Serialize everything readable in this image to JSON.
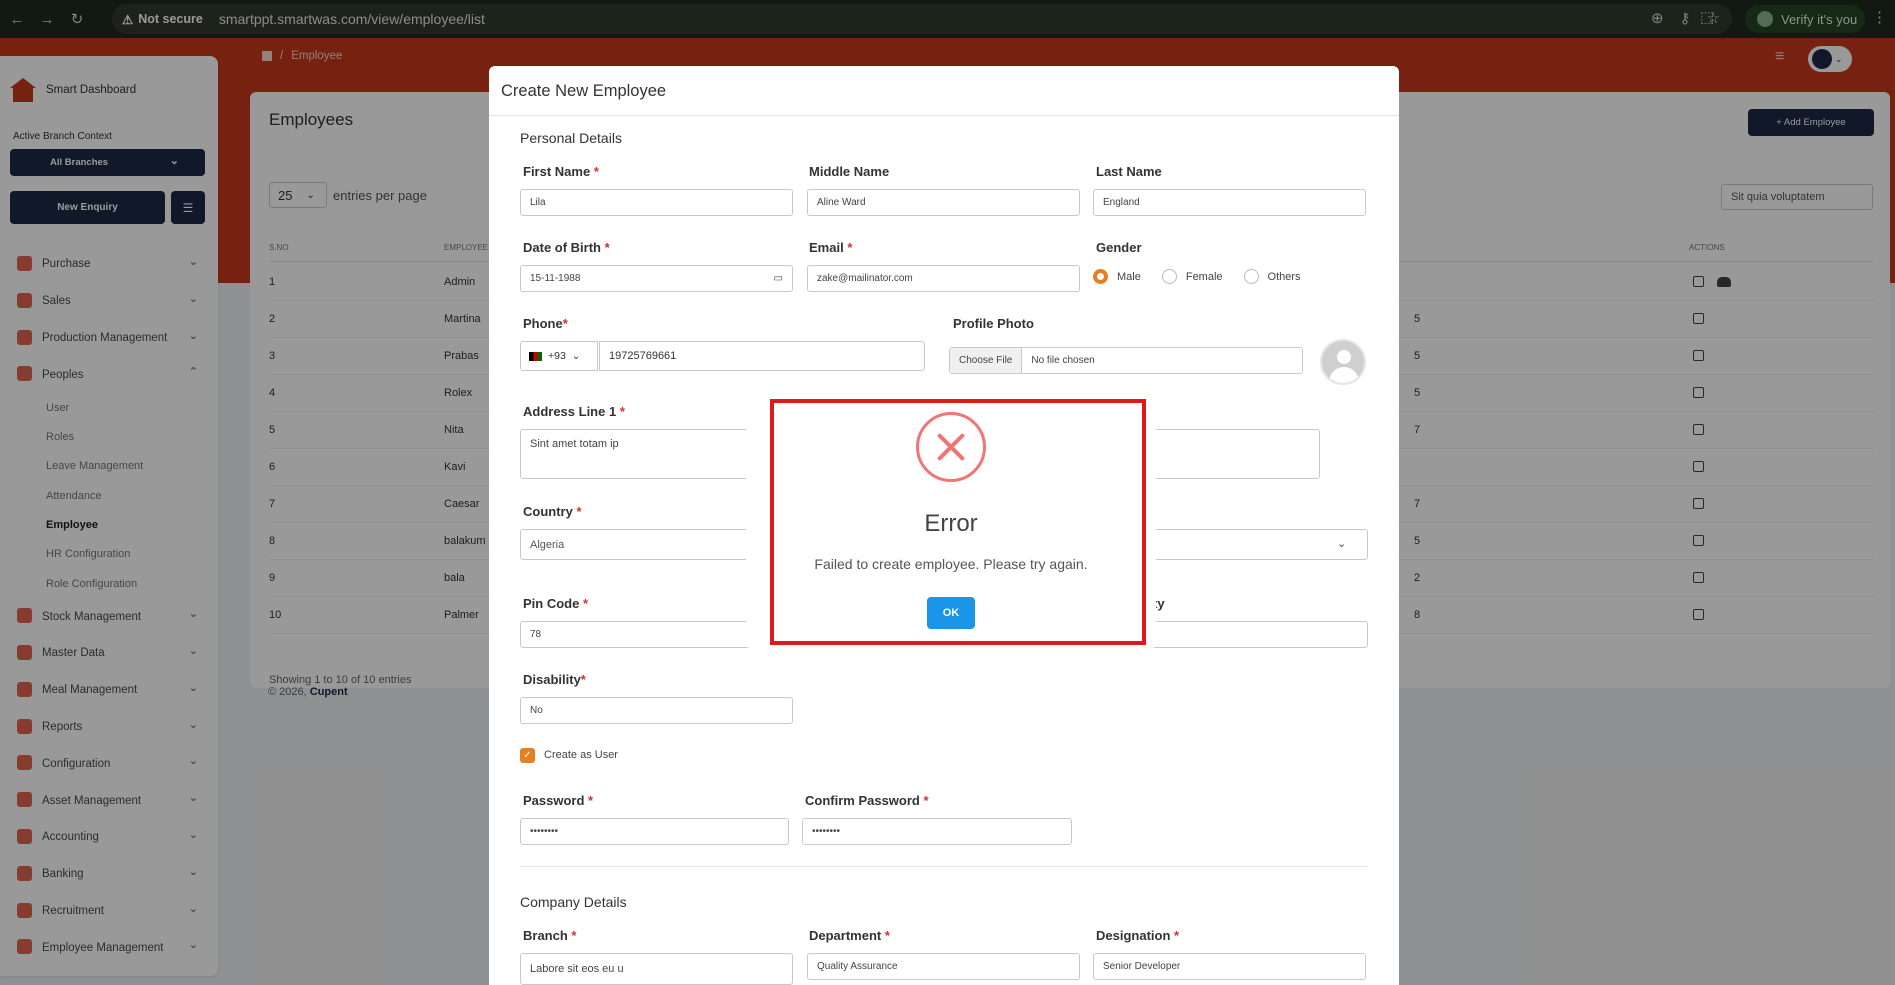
{
  "browser": {
    "security_label": "Not secure",
    "url": "smartppt.smartwas.com/view/employee/list",
    "verify_label": "Verify it's you"
  },
  "sidebar": {
    "brand": "Smart Dashboard",
    "context_label": "Active Branch Context",
    "branch_value": "All Branches",
    "new_enquiry": "New Enquiry",
    "items": [
      {
        "label": "Purchase"
      },
      {
        "label": "Sales"
      },
      {
        "label": "Production Management"
      },
      {
        "label": "Peoples"
      }
    ],
    "peoples_sub": [
      "User",
      "Roles",
      "Leave Management",
      "Attendance",
      "Employee",
      "HR Configuration",
      "Role Configuration"
    ],
    "items_after": [
      {
        "label": "Stock Management"
      },
      {
        "label": "Master Data"
      },
      {
        "label": "Meal Management"
      },
      {
        "label": "Reports"
      },
      {
        "label": "Configuration"
      },
      {
        "label": "Asset Management"
      },
      {
        "label": "Accounting"
      },
      {
        "label": "Banking"
      },
      {
        "label": "Recruitment"
      },
      {
        "label": "Employee Management"
      }
    ]
  },
  "breadcrumb": {
    "current": "Employee",
    "separator": "/"
  },
  "list": {
    "title": "Employees",
    "add_button": "+ Add Employee",
    "page_length": "25",
    "page_length_label": "entries per page",
    "search_value": "Sit quia voluptatem",
    "columns": {
      "sno": "S.NO",
      "employee": "EMPLOYEE",
      "actions": "ACTIONS"
    },
    "rows": [
      {
        "sno": "1",
        "name": "Admin"
      },
      {
        "sno": "2",
        "name": "Martina"
      },
      {
        "sno": "3",
        "name": "Prabas"
      },
      {
        "sno": "4",
        "name": "Rolex"
      },
      {
        "sno": "5",
        "name": "Nita"
      },
      {
        "sno": "6",
        "name": "Kavi"
      },
      {
        "sno": "7",
        "name": "Caesar"
      },
      {
        "sno": "8",
        "name": "balakum"
      },
      {
        "sno": "9",
        "name": "bala"
      },
      {
        "sno": "10",
        "name": "Palmer"
      }
    ],
    "right_fragments": [
      "",
      "5",
      "5",
      "5",
      "7",
      "",
      "7",
      "5",
      "2",
      "8"
    ],
    "showing": "Showing 1 to 10 of 10 entries"
  },
  "footer": {
    "copyright": "© 2026, ",
    "company": "Cupent"
  },
  "modal": {
    "title": "Create New Employee",
    "personal_section": "Personal Details",
    "labels": {
      "first_name": "First Name",
      "middle_name": "Middle Name",
      "last_name": "Last Name",
      "dob": "Date of Birth",
      "email": "Email",
      "gender": "Gender",
      "phone": "Phone",
      "photo": "Profile Photo",
      "address1": "Address Line 1",
      "country": "Country",
      "pincode": "Pin Code",
      "city_fragment": "ty",
      "disability": "Disability",
      "create_user": "Create as User",
      "password": "Password",
      "confirm_password": "Confirm Password",
      "branch": "Branch",
      "department": "Department",
      "designation": "Designation"
    },
    "required_mark": "*",
    "values": {
      "first_name": "Lila",
      "middle_name": "Aline Ward",
      "last_name": "England",
      "dob": "15-11-1988",
      "email": "zake@mailinator.com",
      "phone_code": "+93",
      "phone": "19725769661",
      "file_button": "Choose File",
      "file_status": "No file chosen",
      "address1": "Sint amet totam ip",
      "country": "Algeria",
      "pincode": "78",
      "disability": "No",
      "password": "••••••••",
      "confirm_password": "••••••••",
      "branch": "Labore sit eos eu u",
      "department": "Quality Assurance",
      "designation": "Senior Developer"
    },
    "gender_options": [
      "Male",
      "Female",
      "Others"
    ],
    "company_section": "Company Details"
  },
  "error_dialog": {
    "title": "Error",
    "message": "Failed to create employee. Please try again.",
    "ok": "OK"
  },
  "colors": {
    "brand_red": "#c6381d",
    "navy": "#1b2947",
    "accent_orange": "#e67e22",
    "ok_blue": "#1a95e8",
    "error_red": "#f27474"
  }
}
